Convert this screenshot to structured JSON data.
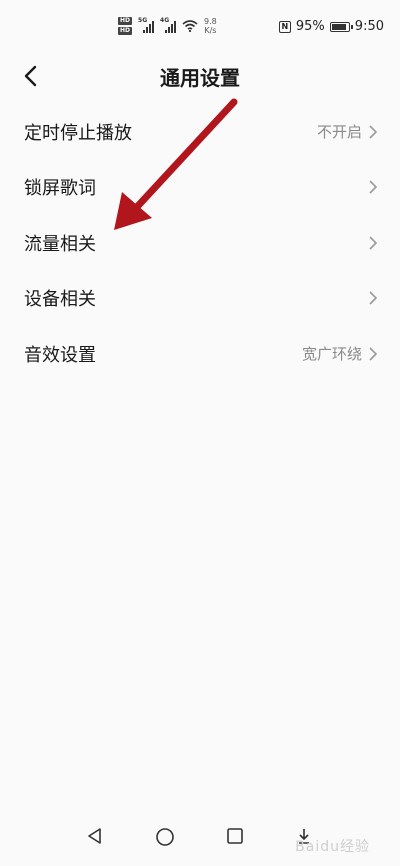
{
  "status_bar": {
    "hd_top": "HD",
    "hd_bottom": "HD",
    "signal_label": "5G",
    "signal2_label": "4G",
    "net_speed_value": "9.8",
    "net_speed_unit": "K/s",
    "nfc_icon": "nfc-icon",
    "battery_percent": "95%",
    "battery_level": 0.95,
    "time": "9:50"
  },
  "header": {
    "back_icon": "chevron-left-icon",
    "title": "通用设置"
  },
  "settings": [
    {
      "label": "定时停止播放",
      "value": "不开启"
    },
    {
      "label": "锁屏歌词",
      "value": ""
    },
    {
      "label": "流量相关",
      "value": ""
    },
    {
      "label": "设备相关",
      "value": ""
    },
    {
      "label": "音效设置",
      "value": "宽广环绕"
    }
  ],
  "annotation": {
    "arrow_color": "#b0161b",
    "points_to": "流量相关"
  },
  "nav_bar": {
    "back_icon": "triangle-back-icon",
    "home_icon": "circle-home-icon",
    "recents_icon": "square-recents-icon",
    "extra_icon": "download-icon"
  },
  "watermark": "Baidu经验"
}
